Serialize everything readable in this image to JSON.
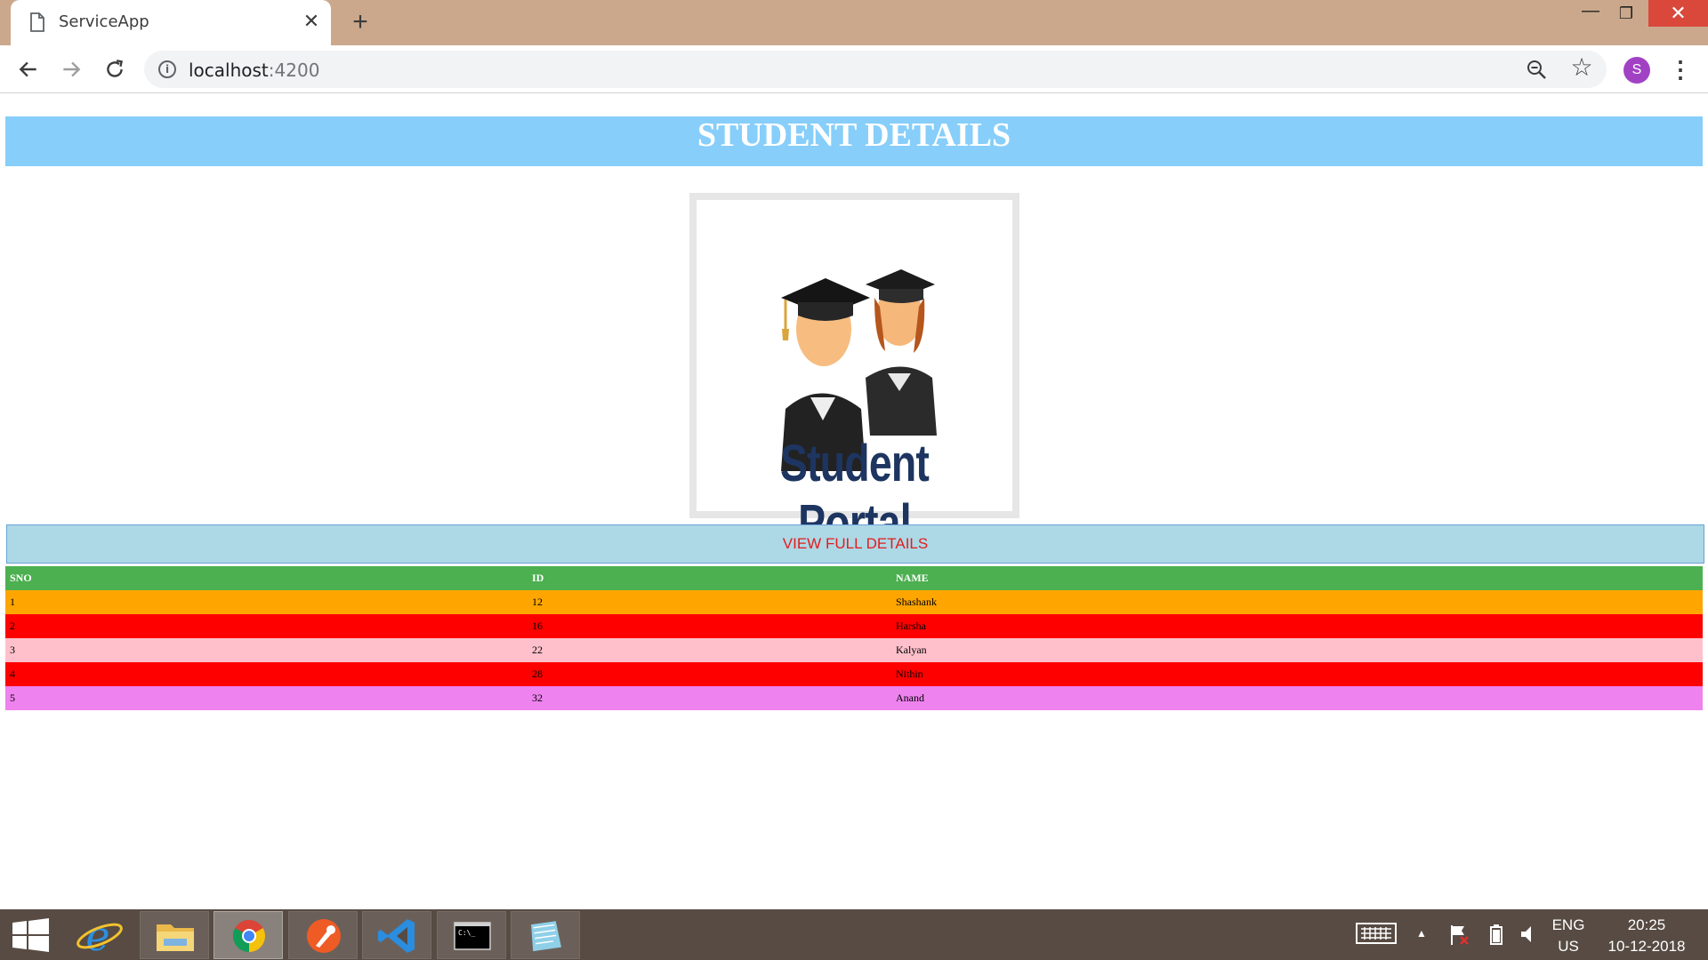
{
  "browser": {
    "tab_title": "ServiceApp",
    "tab_close": "✕",
    "new_tab": "+",
    "window_controls": {
      "minimize": "—",
      "maximize": "❐",
      "close": "✕"
    },
    "url_host": "localhost",
    "url_port": ":4200",
    "profile_initial": "S",
    "icons": [
      "page-icon",
      "back-arrow-icon",
      "forward-arrow-icon",
      "reload-icon",
      "info-icon",
      "zoom-icon",
      "star-icon",
      "menu-icon"
    ]
  },
  "page": {
    "title": "STUDENT DETAILS",
    "logo_text": "Student Portal",
    "view_button_label": "VIEW FULL DETAILS",
    "table": {
      "headers": [
        "SNO",
        "ID",
        "NAME"
      ],
      "rows": [
        {
          "sno": "1",
          "id": "12",
          "name": "Shashank",
          "color": "#ffa500"
        },
        {
          "sno": "2",
          "id": "16",
          "name": "Harsha",
          "color": "#ff0000"
        },
        {
          "sno": "3",
          "id": "22",
          "name": "Kalyan",
          "color": "#ffc0cb"
        },
        {
          "sno": "4",
          "id": "28",
          "name": "Nithin",
          "color": "#ff0000"
        },
        {
          "sno": "5",
          "id": "32",
          "name": "Anand",
          "color": "#ee82ee"
        }
      ]
    },
    "colors": {
      "header_bg": "#87cefa",
      "table_header_bg": "#4caf50",
      "button_bg": "#add8e6",
      "button_text": "#e31c1c"
    }
  },
  "taskbar": {
    "apps": [
      "windows-start-icon",
      "internet-explorer-icon",
      "file-explorer-icon",
      "chrome-icon",
      "postman-icon",
      "vscode-icon",
      "command-prompt-icon",
      "notepad-icon"
    ],
    "language_top": "ENG",
    "language_bottom": "US",
    "time": "20:25",
    "date": "10-12-2018"
  }
}
